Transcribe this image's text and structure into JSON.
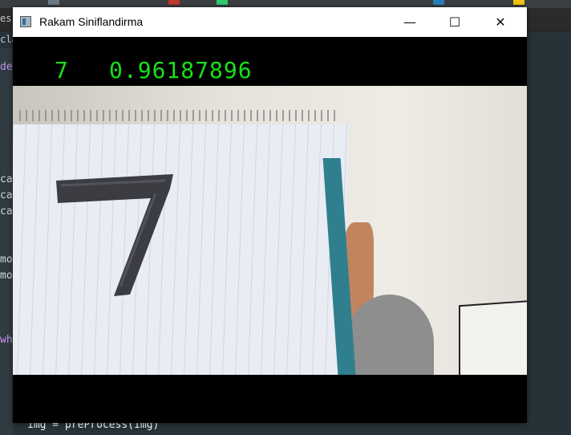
{
  "ide": {
    "tab_fragment": "esl",
    "tab_fragment_2": "clas",
    "code_fragments": [
      "de",
      "ca",
      "ca",
      "ca",
      "mo",
      "mo",
      "wh"
    ],
    "bottom_code": "img = preProcess(img)"
  },
  "window": {
    "title": "Rakam Siniflandirma",
    "minimize_glyph": "—",
    "maximize_glyph": "☐",
    "close_glyph": "✕"
  },
  "result": {
    "digit": "7",
    "confidence": "0.96187896",
    "color": "#19e019"
  }
}
